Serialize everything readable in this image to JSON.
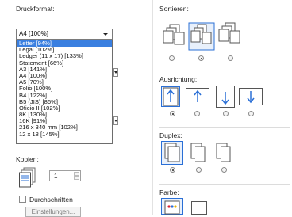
{
  "druckformat": {
    "label": "Druckformat:",
    "selected": "A4 [100%]",
    "options": [
      "Letter [94%]",
      "Legal [102%]",
      "Ledger (11 x 17) [133%]",
      "Statement [66%]",
      "A3 [141%]",
      "A4 [100%]",
      "A5 [70%]",
      "Folio [100%]",
      "B4 [122%]",
      "B5 (JIS) [86%]",
      "Oficio II [102%]",
      "8K [130%]",
      "16K [91%]",
      "216 x 340 mm [102%]",
      "12 x 18 [145%]"
    ],
    "highlighted_index": 0
  },
  "kopien": {
    "label": "Kopien:",
    "value": "1"
  },
  "durchschriften": {
    "label": "Durchschriften",
    "checked": false
  },
  "einstellungen_button": {
    "label": "Einstellungen..."
  },
  "sortieren": {
    "label": "Sortieren:",
    "selected_index": 1
  },
  "ausrichtung": {
    "label": "Ausrichtung:",
    "selected_index": 0
  },
  "duplex": {
    "label": "Duplex:",
    "selected_index": 0
  },
  "farbe": {
    "label": "Farbe:"
  },
  "colors": {
    "accent": "#3a7fe0",
    "highlight_icon": "#2a6fd6"
  }
}
